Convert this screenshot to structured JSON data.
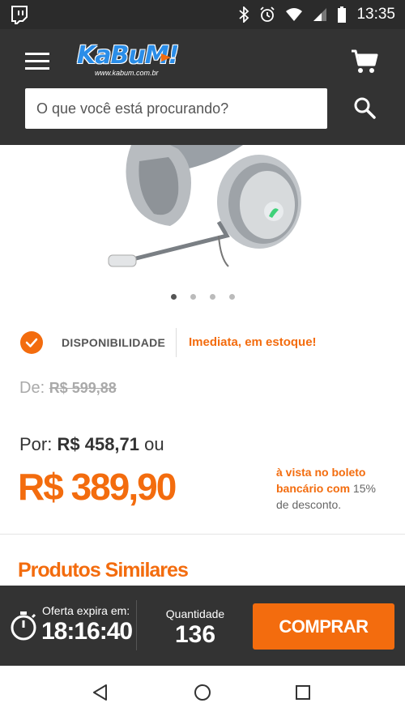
{
  "status_bar": {
    "time": "13:35"
  },
  "header": {
    "logo_text": "KaBuM!",
    "logo_subtext": "www.kabum.com.br",
    "search_placeholder": "O que você está procurando?"
  },
  "gallery": {
    "slide_count": 4,
    "active_slide": 1
  },
  "availability": {
    "label": "DISPONIBILIDADE",
    "value": "Imediata, em estoque!"
  },
  "pricing": {
    "old_label": "De:",
    "old_price": "R$ 599,88",
    "card_label": "Por:",
    "card_price": "R$ 458,71",
    "card_suffix": "ou",
    "cash_price": "R$ 389,90",
    "boleto_highlight": "à vista no boleto bancário com",
    "boleto_rest": "15% de desconto."
  },
  "similar": {
    "title": "Produtos Similares"
  },
  "offer_bar": {
    "expires_label": "Oferta expira em:",
    "expires_time": "18:16:40",
    "quantity_label": "Quantidade",
    "quantity_value": "136",
    "buy_label": "COMPRAR"
  },
  "colors": {
    "accent": "#f36c0e",
    "header_bg": "#333333",
    "logo_blue": "#2a8de8"
  },
  "icons": [
    "twitch-icon",
    "bluetooth-icon",
    "alarm-icon",
    "wifi-icon",
    "signal-icon",
    "battery-icon",
    "menu-icon",
    "cart-icon",
    "search-icon",
    "check-icon",
    "stopwatch-icon",
    "back-icon",
    "home-icon",
    "recent-apps-icon"
  ]
}
